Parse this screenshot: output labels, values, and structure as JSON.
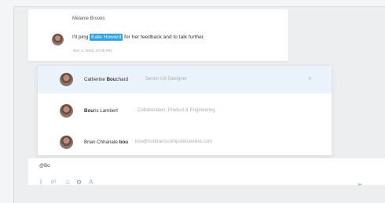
{
  "message": {
    "author": "Melanie Brooks",
    "text_before": "I'll ping",
    "mention": "Kate Howard",
    "text_after": "for her feedback and to talk further.",
    "timestamp": "Nov 4, 2019, 10:05 PM"
  },
  "mention_suggestions": [
    {
      "name_prefix": "Catherine ",
      "name_match": "Bou",
      "name_suffix": "chard",
      "detail": "Senior UX Designer",
      "selected": true
    },
    {
      "name_prefix": "",
      "name_match": "Bou",
      "name_suffix": "ris Lambert",
      "detail": "Collaboration, Product & Engineering",
      "selected": false
    },
    {
      "name_prefix": "Brian Chhanate ",
      "name_match": "bou",
      "name_suffix": "",
      "detail": "bou@outbrainscomputersonline.com",
      "selected": false
    }
  ],
  "composer": {
    "value": "@Bo"
  },
  "toolbar": {
    "icons": [
      "paperclip-icon",
      "gif-icon",
      "emoji-icon",
      "settings-icon",
      "text-format-icon"
    ],
    "send_icon": "send-icon"
  },
  "colors": {
    "mention_bg": "#2fa2e7",
    "selected_row_bg": "#eaf3fb",
    "chevron": "#2f8fd8"
  }
}
